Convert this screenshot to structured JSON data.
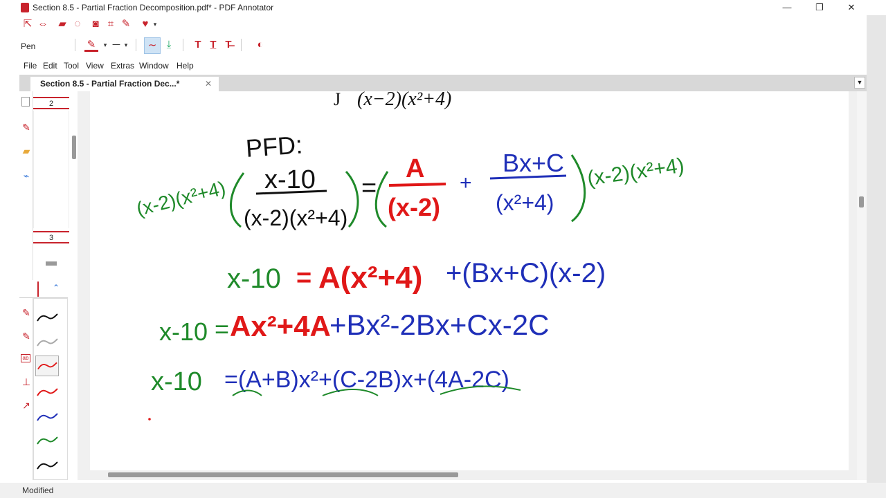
{
  "window": {
    "title": "Section 8.5 - Partial Fraction Decomposition.pdf* - PDF Annotator",
    "minimize": "—",
    "maximize": "❐",
    "close": "✕"
  },
  "toolbar": {
    "tool_label": "Pen",
    "pen_color": "#c8232c",
    "buttons": [
      "pen-tool-icon",
      "highlighter-icon",
      "eraser-icon",
      "lasso-icon",
      "camera-icon",
      "crop-icon",
      "marker-icon",
      "heart-icon"
    ]
  },
  "menu": {
    "items": [
      {
        "label": "File"
      },
      {
        "label": "Edit"
      },
      {
        "label": "Tool"
      },
      {
        "label": "View"
      },
      {
        "label": "Extras"
      },
      {
        "label": "Window"
      },
      {
        "label": "Help"
      }
    ]
  },
  "tab": {
    "label": "Section 8.5 - Partial Fraction Dec...*",
    "close": "✕",
    "dropdown": "▼"
  },
  "thumbnails": {
    "pages": [
      "2",
      "3"
    ]
  },
  "document": {
    "header_math": "(x−2)(x²+4)",
    "header_prefix": "J",
    "ink": {
      "pfd_label": "PFD:",
      "multiplier_left": "(x-2)(x²+4)",
      "numerator": "x-10",
      "denominator": "(x-2)(x²+4)",
      "equals": "=",
      "frac_a_num": "A",
      "frac_a_den": "(x-2)",
      "plus": "+",
      "frac_b_num": "Bx+C",
      "frac_b_den": "(x²+4)",
      "multiplier_right": "(x-2)(x²+4)",
      "line2_lhs": "x-10",
      "line2_eq": "=",
      "line2_a": "A(x²+4)",
      "line2_rest": "+(Bx+C)(x-2)",
      "line3_lhs": "x-10",
      "line3_eq": "=",
      "line3_red": "Ax²+4A",
      "line3_blue": "+Bx²-2Bx+Cx-2C",
      "line4_lhs": "x-10",
      "line4_rhs": "=(A+B)x²+(C-2B)x+(4A-2C)"
    },
    "colors": {
      "green": "#1f8a2a",
      "red": "#e01818",
      "blue": "#1f2fb8",
      "black": "#111111"
    }
  },
  "status": {
    "text": "Modified"
  }
}
